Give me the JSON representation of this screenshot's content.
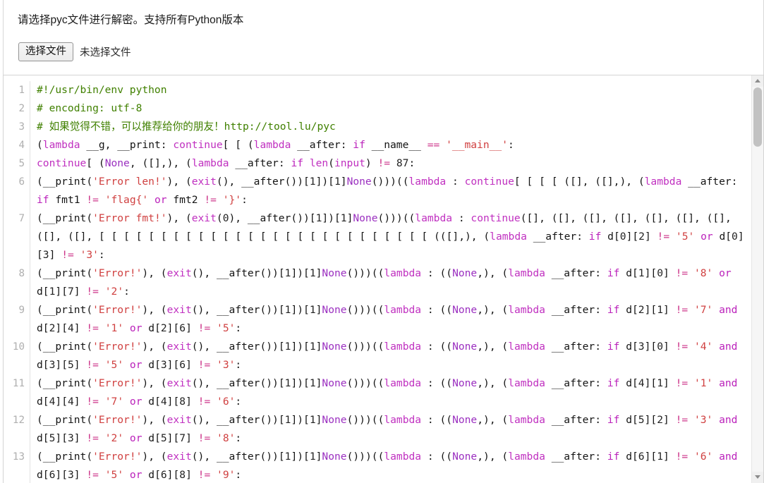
{
  "header": {
    "instruction": "请选择pyc文件进行解密。支持所有Python版本",
    "choose_file_label": "选择文件",
    "no_file_label": "未选择文件"
  },
  "editor": {
    "line_numbers": [
      "1",
      "2",
      "3",
      "4",
      "5",
      "6",
      "7",
      "8",
      "9",
      "10",
      "11",
      "12",
      "13"
    ],
    "scrollbar": {
      "up_arrow": "scroll-up-arrow",
      "down_arrow": "scroll-down-arrow"
    },
    "colors": {
      "comment": "#408000",
      "keyword": "#c030c0",
      "control": "#bb22bb",
      "string": "#d04040",
      "none": "#9b30c0",
      "plain": "#141414",
      "gutter": "#afafaf"
    },
    "lines": [
      {
        "n": "1",
        "text": "#!/usr/bin/env python"
      },
      {
        "n": "2",
        "text": "# encoding: utf-8"
      },
      {
        "n": "3",
        "text": "# 如果觉得不错，可以推荐给你的朋友！http://tool.lu/pyc"
      },
      {
        "n": "4",
        "text": "(lambda __g, __print: continue[ [ (lambda __after: if __name__ == '__main__':"
      },
      {
        "n": "5",
        "text": "continue[ (None, ([],), (lambda __after: if len(input) != 87:"
      },
      {
        "n": "6",
        "text": "(__print('Error len!'), (exit(), __after())[1])[1]None()))((lambda : continue[ [ [ [ ([], ([],), (lambda __after: if fmt1 != 'flag{' or fmt2 != '}':"
      },
      {
        "n": "7",
        "text": "(__print('Error fmt!'), (exit(0), __after())[1])[1]None()))((lambda : continue([], ([], ([], ([], ([], ([], ([], ([], ([], [ [ [ [ [ [ [ [ [ [ [ [ [ [ [ [ [ [ [ [ [ [ [ [ [ [ [ (([],), (lambda __after: if d[0][2] != '5' or d[0][3] != '3':"
      },
      {
        "n": "8",
        "text": "(__print('Error!'), (exit(), __after())[1])[1]None()))((lambda : ((None,), (lambda __after: if d[1][0] != '8' or d[1][7] != '2':"
      },
      {
        "n": "9",
        "text": "(__print('Error!'), (exit(), __after())[1])[1]None()))((lambda : ((None,), (lambda __after: if d[2][1] != '7' and d[2][4] != '1' or d[2][6] != '5':"
      },
      {
        "n": "10",
        "text": "(__print('Error!'), (exit(), __after())[1])[1]None()))((lambda : ((None,), (lambda __after: if d[3][0] != '4' and d[3][5] != '5' or d[3][6] != '3':"
      },
      {
        "n": "11",
        "text": "(__print('Error!'), (exit(), __after())[1])[1]None()))((lambda : ((None,), (lambda __after: if d[4][1] != '1' and d[4][4] != '7' or d[4][8] != '6':"
      },
      {
        "n": "12",
        "text": "(__print('Error!'), (exit(), __after())[1])[1]None()))((lambda : ((None,), (lambda __after: if d[5][2] != '3' and d[5][3] != '2' or d[5][7] != '8':"
      },
      {
        "n": "13",
        "text": "(__print('Error!'), (exit(), __after())[1])[1]None()))((lambda : ((None,), (lambda __after: if d[6][1] != '6' and d[6][3] != '5' or d[6][8] != '9':"
      }
    ]
  }
}
